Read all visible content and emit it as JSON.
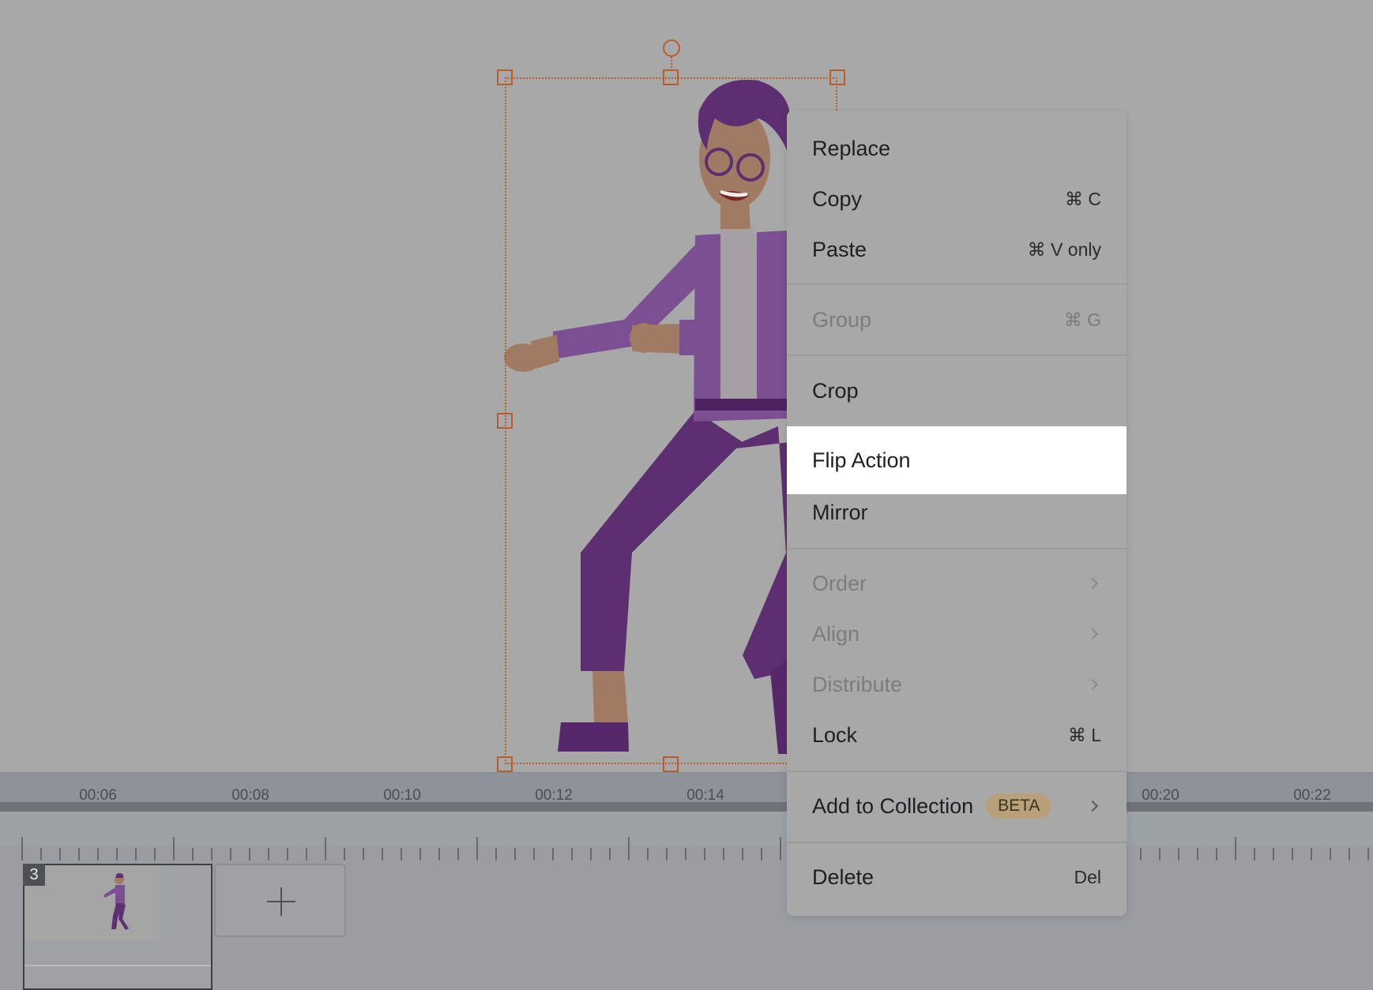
{
  "context_menu": {
    "items": [
      {
        "label": "Replace",
        "shortcut": "",
        "disabled": false
      },
      {
        "label": "Copy",
        "shortcut": "⌘ C",
        "disabled": false
      },
      {
        "label": "Paste",
        "shortcut": "⌘ V only",
        "disabled": false
      },
      {
        "label": "Group",
        "shortcut": "⌘ G",
        "disabled": true
      },
      {
        "label": "Crop",
        "shortcut": "",
        "disabled": false
      },
      {
        "label": "Flip Action",
        "shortcut": "",
        "disabled": false,
        "highlighted": true
      },
      {
        "label": "Mirror",
        "shortcut": "",
        "disabled": false
      },
      {
        "label": "Order",
        "submenu": true,
        "disabled": true
      },
      {
        "label": "Align",
        "submenu": true,
        "disabled": true
      },
      {
        "label": "Distribute",
        "submenu": true,
        "disabled": true
      },
      {
        "label": "Lock",
        "shortcut": "⌘ L",
        "disabled": false
      },
      {
        "label": "Add to Collection",
        "badge": "BETA",
        "submenu": true,
        "disabled": false
      },
      {
        "label": "Delete",
        "shortcut": "Del",
        "disabled": false
      }
    ]
  },
  "timeline": {
    "tick_labels": [
      "00:06",
      "00:08",
      "00:10",
      "00:12",
      "00:14",
      "00:20",
      "00:22"
    ],
    "scene_number": "3",
    "add_scene_icon": "plus-icon"
  },
  "colors": {
    "selection": "#b3602e",
    "character_purple": "#6a3a82",
    "menu_highlight": "#ffffff",
    "beta_badge": "#b8a07a"
  }
}
